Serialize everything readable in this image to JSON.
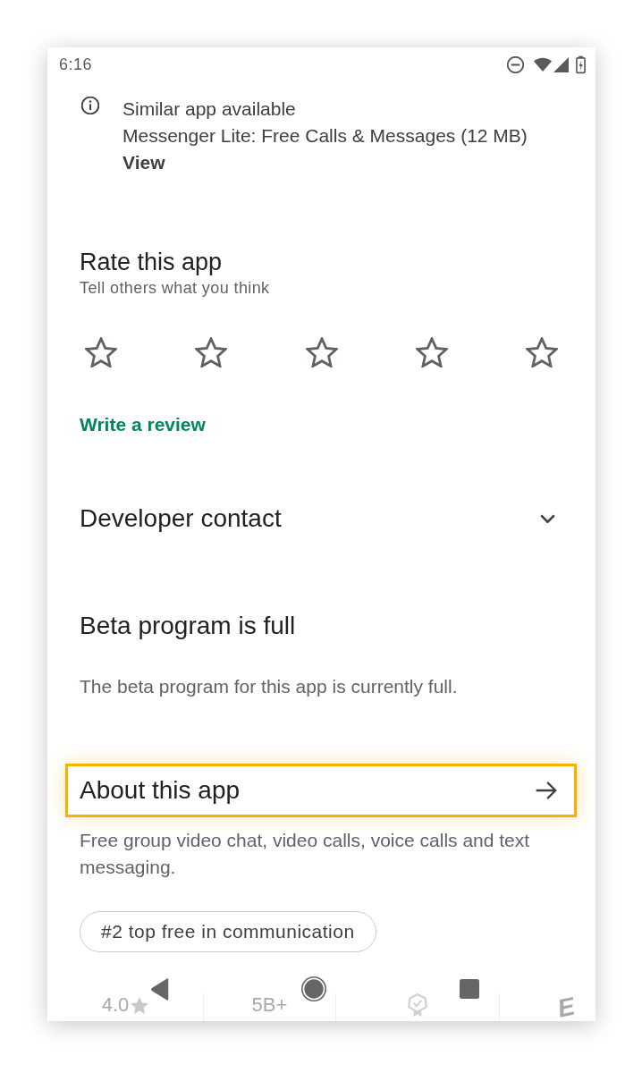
{
  "status_bar": {
    "time": "6:16"
  },
  "notice": {
    "title": "Similar app available",
    "app": "Messenger Lite: Free Calls & Messages (12 MB)",
    "action": "View"
  },
  "rate": {
    "title": "Rate this app",
    "subtitle": "Tell others what you think",
    "stars": 0,
    "action": "Write a review"
  },
  "developer_contact": {
    "title": "Developer contact",
    "expanded": false
  },
  "beta": {
    "title": "Beta program is full",
    "text": "The beta program for this app is currently full."
  },
  "about": {
    "title": "About this app",
    "highlighted": true,
    "description": "Free group video chat, video calls, voice calls and text messaging.",
    "chips": [
      "#2 top free in communication"
    ]
  },
  "stats": [
    {
      "kind": "rating",
      "text": "4.0"
    },
    {
      "kind": "text",
      "text": "5B+"
    },
    {
      "kind": "badge"
    },
    {
      "kind": "letter",
      "text": "E"
    }
  ]
}
